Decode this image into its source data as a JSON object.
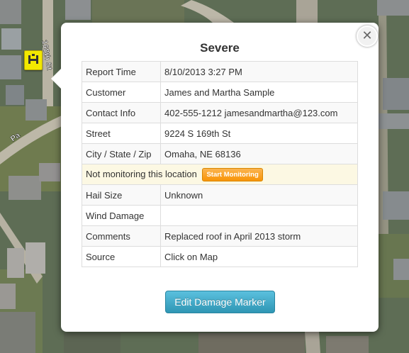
{
  "popup": {
    "title": "Severe",
    "close_icon": "close-icon",
    "rows_top": [
      {
        "label": "Report Time",
        "value": "8/10/2013 3:27 PM"
      },
      {
        "label": "Customer",
        "value": "James and Martha Sample"
      },
      {
        "label": "Contact Info",
        "value": "402-555-1212 jamesandmartha@123.com"
      },
      {
        "label": "Street",
        "value": "9224 S 169th St"
      },
      {
        "label": "City / State / Zip",
        "value": "Omaha, NE 68136"
      }
    ],
    "notice": {
      "text": "Not monitoring this location",
      "button_label": "Start Monitoring"
    },
    "rows_bottom": [
      {
        "label": "Hail Size",
        "value": "Unknown"
      },
      {
        "label": "Wind Damage",
        "value": ""
      },
      {
        "label": "Comments",
        "value": "Replaced roof in April 2013 storm"
      },
      {
        "label": "Source",
        "value": "Click on Map"
      }
    ],
    "edit_button_label": "Edit Damage Marker"
  },
  "map": {
    "street_labels": [
      "168th St",
      "Pa"
    ],
    "marker_icon": "hail-marker-icon",
    "marker_color": "#f2e800"
  },
  "colors": {
    "notice_bg": "#fcf8e3",
    "start_button": "#f89406",
    "edit_button": "#2f96b4"
  }
}
